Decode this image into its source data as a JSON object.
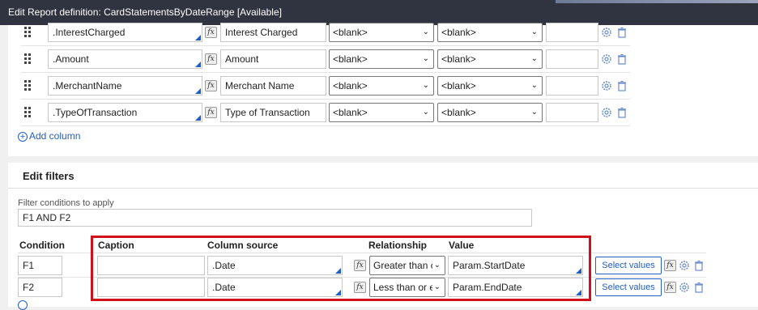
{
  "window": {
    "title": "Edit  Report definition: CardStatementsByDateRange [Available]"
  },
  "columns": {
    "rows": [
      {
        "property": ".InterestCharged",
        "label": "Interest Charged",
        "sel1": "<blank>",
        "sel2": "<blank>"
      },
      {
        "property": ".Amount",
        "label": "Amount",
        "sel1": "<blank>",
        "sel2": "<blank>"
      },
      {
        "property": ".MerchantName",
        "label": "Merchant Name",
        "sel1": "<blank>",
        "sel2": "<blank>"
      },
      {
        "property": ".TypeOfTransaction",
        "label": "Type of Transaction",
        "sel1": "<blank>",
        "sel2": "<blank>"
      }
    ],
    "add_label": "Add column"
  },
  "filters": {
    "title": "Edit filters",
    "conditions_label": "Filter conditions to apply",
    "conditions_value": "F1 AND F2",
    "headers": {
      "condition": "Condition",
      "caption": "Caption",
      "column_source": "Column source",
      "relationship": "Relationship",
      "value": "Value"
    },
    "rows": [
      {
        "condition": "F1",
        "caption": "",
        "column_source": ".Date",
        "relationship": "Greater than c",
        "value": "Param.StartDate",
        "select_values": "Select values"
      },
      {
        "condition": "F2",
        "caption": "",
        "column_source": ".Date",
        "relationship": "Less than or e",
        "value": "Param.EndDate",
        "select_values": "Select values"
      }
    ]
  },
  "icons": {
    "fx": "fx-icon",
    "gear": "gear-icon",
    "trash": "trash-icon",
    "chevron": "chevron-down-icon",
    "drag": "drag-handle-icon"
  },
  "colors": {
    "titlebar": "#2f3440",
    "accent": "#1f5fc8",
    "highlight": "#d0101b"
  }
}
